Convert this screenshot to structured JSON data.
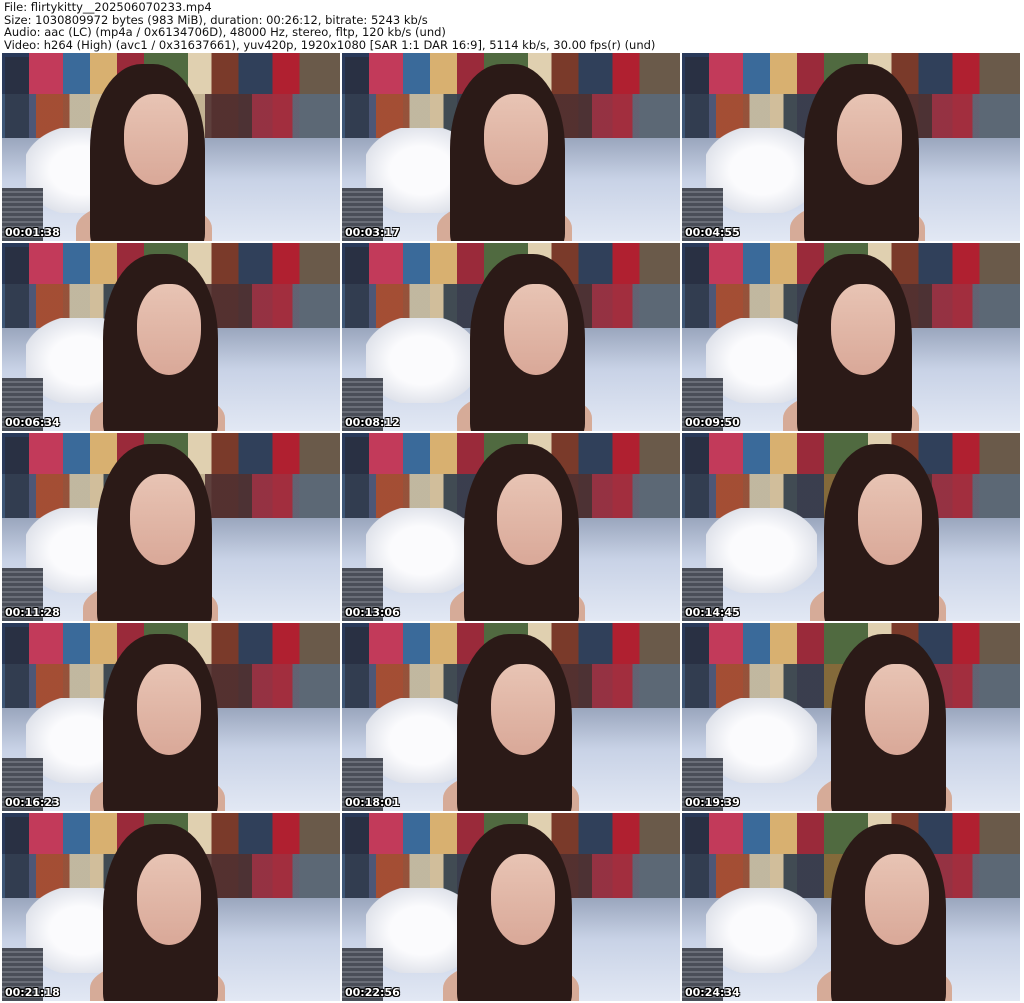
{
  "header": {
    "file": "File: flirtykitty__202506070233.mp4",
    "size": "Size: 1030809972 bytes (983 MiB), duration: 00:26:12, bitrate: 5243 kb/s",
    "audio": "Audio: aac (LC) (mp4a / 0x6134706D), 48000 Hz, stereo, fltp, 120 kb/s (und)",
    "video": "Video: h264 (High) (avc1 / 0x31637661), yuv420p, 1920x1080 [SAR 1:1 DAR 16:9], 5114 kb/s, 30.00 fps(r) (und)"
  },
  "thumbnails": [
    {
      "timestamp": "00:01:38"
    },
    {
      "timestamp": "00:03:17"
    },
    {
      "timestamp": "00:04:55"
    },
    {
      "timestamp": "00:06:34"
    },
    {
      "timestamp": "00:08:12"
    },
    {
      "timestamp": "00:09:50"
    },
    {
      "timestamp": "00:11:28"
    },
    {
      "timestamp": "00:13:06"
    },
    {
      "timestamp": "00:14:45"
    },
    {
      "timestamp": "00:16:23"
    },
    {
      "timestamp": "00:18:01"
    },
    {
      "timestamp": "00:19:39"
    },
    {
      "timestamp": "00:21:18"
    },
    {
      "timestamp": "00:22:56"
    },
    {
      "timestamp": "00:24:34"
    }
  ]
}
